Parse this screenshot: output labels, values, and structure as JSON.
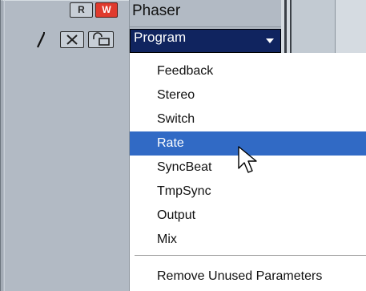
{
  "track": {
    "read_label": "R",
    "write_label": "W",
    "name": "Phaser",
    "close_label": "×"
  },
  "parameter": {
    "selected": "Program"
  },
  "menu": {
    "items": [
      {
        "label": "Feedback"
      },
      {
        "label": "Stereo"
      },
      {
        "label": "Switch"
      },
      {
        "label": "Rate",
        "selected": true
      },
      {
        "label": "SyncBeat"
      },
      {
        "label": "TmpSync"
      },
      {
        "label": "Output"
      },
      {
        "label": "Mix"
      }
    ],
    "footer_item": "Remove Unused Parameters"
  },
  "icons": {
    "pencil": "pencil-icon",
    "lock": "lock-icon",
    "cursor": "mouse-cursor-icon",
    "dropdown": "chevron-down-icon"
  },
  "colors": {
    "panel": "#b2bac4",
    "write_button": "#e03a2d",
    "dropdown_bg": "#10245f",
    "selection": "#316ac5"
  }
}
